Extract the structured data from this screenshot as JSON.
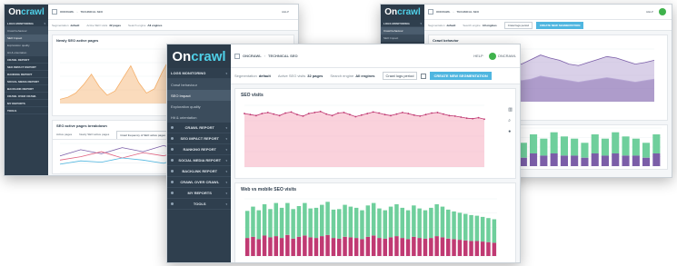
{
  "brand": {
    "logo_on": "On",
    "logo_rest": "crawl"
  },
  "breadcrumb": {
    "project": "ONCRAWL",
    "section": "TECHNICAL SEO"
  },
  "topbar": {
    "help": "HELP",
    "user": "ONCRAWL"
  },
  "nav": {
    "logs_monitoring": "LOGS MONITORING",
    "sub": [
      "Crawl behaviour",
      "SEO Impact",
      "Exploration quality",
      "Hit & orientation"
    ],
    "groups": [
      "CRAWL REPORT",
      "SEO IMPACT REPORT",
      "RANKING REPORT",
      "SOCIAL MEDIA REPORT",
      "BACKLINK REPORT",
      "CRAWL OVER CRAWL",
      "MY REPORTS",
      "TOOLS"
    ]
  },
  "filters": {
    "segmentation_label": "Segmentation",
    "segmentation_value": "default",
    "pages_label": "Active SEO visits",
    "pages_value": "32 pages",
    "engines_label": "Search engine",
    "engines_value": "All engines",
    "period": "Crawl logs period",
    "cta": "CREATE NEW SEGMENTATION"
  },
  "left_window": {
    "chart1_title": "Newly SEO active pages",
    "chart2_title": "SEO active pages breakdown",
    "tabs": [
      "Active pages",
      "Newly SEO active pages",
      "Crawl frequency of SEO active pages"
    ]
  },
  "right_window": {
    "chart1_title": "Crawl behavior",
    "legend": [
      "Crawled pages",
      "New pages",
      "Orphan pages"
    ]
  },
  "main_window": {
    "chart1_title": "SEO visits",
    "chart2_title": "Web vs mobile SEO visits"
  },
  "colors": {
    "sidebar": "#2f3f4e",
    "accent": "#4fb6e0",
    "orange": "#f5b06b",
    "pink": "#f7b4c4",
    "green": "#6fcf9c",
    "magenta": "#c03a73",
    "purple": "#7b5ea8",
    "lavender": "#b9a9d6"
  },
  "chart_data": [
    {
      "type": "area",
      "title": "Newly SEO active pages",
      "values": [
        2,
        3,
        5,
        9,
        14,
        8,
        4,
        6,
        12,
        18,
        10,
        5,
        7,
        15,
        22,
        11,
        6,
        9,
        16,
        24,
        13,
        7,
        10,
        19,
        12,
        6,
        8,
        14,
        9,
        5
      ]
    },
    {
      "type": "line",
      "title": "SEO active pages breakdown",
      "series": [
        {
          "values": [
            40,
            55,
            45,
            60,
            50,
            65,
            48,
            58,
            44,
            62,
            52,
            46
          ]
        },
        {
          "values": [
            30,
            38,
            50,
            35,
            48,
            40,
            55,
            42,
            36,
            45,
            38,
            34
          ]
        },
        {
          "values": [
            20,
            28,
            25,
            35,
            30,
            22,
            38,
            26,
            30,
            24,
            28,
            22
          ]
        }
      ]
    },
    {
      "type": "area",
      "title": "Crawl behavior",
      "series": [
        {
          "values": [
            40,
            45,
            55,
            50,
            48,
            52,
            60,
            58,
            54,
            50,
            56,
            62,
            58,
            55,
            50,
            48,
            52,
            56,
            60,
            58,
            54,
            50,
            52,
            55
          ]
        },
        {
          "values": [
            20,
            25,
            30,
            28,
            26,
            30,
            34,
            32,
            30,
            28,
            30,
            34,
            32,
            30,
            28,
            26,
            28,
            30,
            32,
            30,
            28,
            26,
            28,
            30
          ]
        }
      ]
    },
    {
      "type": "bar",
      "title": "Crawl behavior bars",
      "series": [
        {
          "values": [
            6,
            8,
            7,
            9,
            8,
            10,
            9,
            8,
            7,
            9,
            8,
            10,
            9,
            8,
            7,
            9,
            8,
            10,
            9,
            8,
            7,
            9
          ]
        },
        {
          "values": [
            4,
            5,
            4,
            6,
            5,
            6,
            5,
            5,
            4,
            6,
            5,
            6,
            5,
            5,
            4,
            6,
            5,
            6,
            5,
            5,
            4,
            6
          ]
        }
      ]
    },
    {
      "type": "area",
      "title": "SEO visits",
      "ylim": [
        0,
        6000
      ],
      "values": [
        5200,
        5100,
        5000,
        5200,
        5300,
        5150,
        5000,
        5250,
        5350,
        5100,
        4950,
        5200,
        5300,
        5400,
        5150,
        5000,
        5250,
        5300,
        5100,
        4900,
        5050,
        5200,
        5350,
        5250,
        5100,
        5000,
        5150,
        5300,
        5200,
        5050,
        4950,
        5100,
        5250,
        5300,
        5150,
        5000,
        4950,
        4850,
        4750,
        4700,
        4800,
        4650
      ]
    },
    {
      "type": "bar",
      "title": "Web vs mobile SEO visits",
      "series": [
        {
          "name": "mobile",
          "values": [
            45,
            50,
            48,
            52,
            47,
            55,
            50,
            53,
            49,
            51,
            54,
            48,
            50,
            52,
            55,
            47,
            49,
            53,
            51,
            50,
            48,
            52,
            54,
            49,
            47,
            51,
            53,
            50,
            48,
            52,
            49,
            47,
            50,
            53,
            51,
            48,
            46,
            45,
            44,
            43,
            42,
            41,
            40,
            39
          ]
        },
        {
          "name": "web",
          "values": [
            30,
            32,
            28,
            34,
            31,
            33,
            30,
            35,
            29,
            32,
            34,
            31,
            30,
            33,
            35,
            30,
            29,
            32,
            31,
            30,
            28,
            32,
            34,
            30,
            29,
            31,
            33,
            30,
            28,
            32,
            30,
            29,
            30,
            33,
            31,
            29,
            28,
            27,
            26,
            25,
            25,
            24,
            23,
            22
          ]
        }
      ]
    }
  ]
}
